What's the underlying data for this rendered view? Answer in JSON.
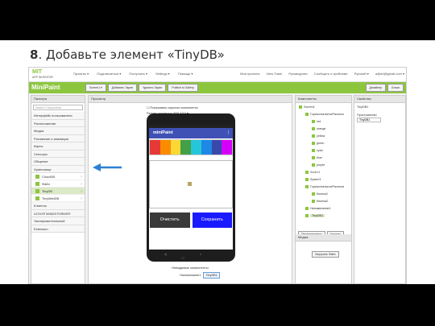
{
  "slide": {
    "step_number": "8",
    "title": ". Добавьте элемент «TinyDB»"
  },
  "app": {
    "logo": {
      "line1": "MIT",
      "line2": "APP INVENTOR"
    },
    "top_menu": [
      "Проекты ▾",
      "Подключиться ▾",
      "Построить ▾",
      "Settings ▾",
      "Помощь ▾"
    ],
    "top_right": [
      "Мои проекты",
      "View Trash",
      "Руководство",
      "Сообщить о проблеме",
      "Русский ▾",
      "a@dd@gmail.com ▾"
    ],
    "project_name": "MiniPaint",
    "toolbar": [
      "Screen1 ▾",
      "Добавить Экран",
      "Удалить Экран",
      "Publish to Gallery"
    ],
    "toolbar_right": [
      "Дизайнер",
      "Блоки"
    ],
    "palette": {
      "header": "Палитра",
      "search_placeholder": "Search Components...",
      "categories_top": [
        "Интерфейс пользователя",
        "Расположение",
        "Медиа",
        "Рисование и анимация",
        "Карты",
        "Сенсоры",
        "Общение",
        "Хранилище"
      ],
      "components": [
        {
          "label": "CloudDB",
          "selected": false
        },
        {
          "label": "Файл",
          "selected": false
        },
        {
          "label": "TinyDB",
          "selected": true
        },
        {
          "label": "TinyWebDB",
          "selected": false
        }
      ],
      "categories_bottom": [
        "Клиенты",
        "LEGO® MINDSTORMS®",
        "Экспериментальный",
        "Extension"
      ]
    },
    "viewer": {
      "header": "Просмотр",
      "checkbox_hidden": "Показывать скрытые компоненты",
      "phone_size": "Размер телефона (505,320) ▾",
      "status_time": "9:48",
      "screen_title": "miniPaint",
      "menu_dots": "⋮",
      "palette_colors": [
        "#e53935",
        "#fb8c00",
        "#fdd835",
        "#43a047",
        "#26c6da",
        "#1e88e5",
        "#3949ab",
        "#d500f9"
      ],
      "btn_clear": "Очистить",
      "btn_save": "Сохранить",
      "btn_clear_color": "#3a3a3a",
      "btn_save_color": "#1a1aff",
      "nav_keys": "◁ ○ □",
      "nonvisible_label": "Невидимые компоненты",
      "nonvisible_items": [
        "Напоминание1",
        "TinyDB1"
      ]
    },
    "components": {
      "header": "Компоненты",
      "tree": [
        {
          "label": "Screen1",
          "indent": 0
        },
        {
          "label": "ГоризонтальноеРасполо",
          "indent": 1
        },
        {
          "label": "red",
          "indent": 2
        },
        {
          "label": "orange",
          "indent": 2
        },
        {
          "label": "yellow",
          "indent": 2
        },
        {
          "label": "green",
          "indent": 2
        },
        {
          "label": "cyan",
          "indent": 2
        },
        {
          "label": "blue",
          "indent": 2
        },
        {
          "label": "purple",
          "indent": 2
        },
        {
          "label": "Холст1",
          "indent": 1
        },
        {
          "label": "Spacer1",
          "indent": 1
        },
        {
          "label": "ГоризонтальноеРаспола",
          "indent": 1
        },
        {
          "label": "Кнопка1",
          "indent": 2
        },
        {
          "label": "Кнопка2",
          "indent": 2
        },
        {
          "label": "Напоминание1",
          "indent": 1
        },
        {
          "label": "TinyDB1",
          "indent": 1,
          "highlight": true
        }
      ],
      "btn_rename": "Переименовать",
      "btn_delete": "Удалить",
      "media_header": "Медиа",
      "btn_upload": "Загрузить Файл"
    },
    "properties": {
      "header": "Свойства",
      "component_name": "TinyDB1",
      "namespace_label": "Пространство",
      "namespace_value": "TinyDB1"
    }
  },
  "arrow_color": "#2d7fd3"
}
